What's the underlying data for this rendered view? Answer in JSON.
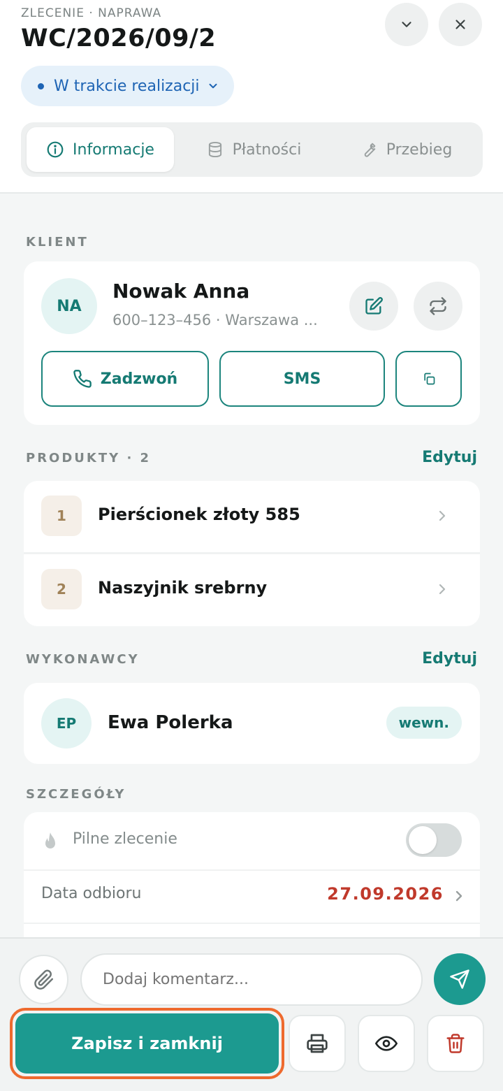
{
  "header": {
    "eyebrow": "ZLECENIE · NAPRAWA",
    "order_number": "WC/2026/09/2",
    "status_label": "W trakcie realizacji",
    "collapse_icon": "chevron-down-icon",
    "close_icon": "close-icon"
  },
  "tabs": [
    {
      "label": "Informacje",
      "icon": "info-icon",
      "active": true
    },
    {
      "label": "Płatności",
      "icon": "database-icon",
      "active": false
    },
    {
      "label": "Przebieg",
      "icon": "wrench-icon",
      "active": false
    }
  ],
  "client": {
    "section_label": "KLIENT",
    "initials": "NA",
    "name": "Nowak Anna",
    "subtitle": "600–123–456 · Warszawa ...",
    "call_label": "Zadzwoń",
    "sms_label": "SMS"
  },
  "products": {
    "section_label": "PRODUKTY · 2",
    "edit_label": "Edytuj",
    "items": [
      {
        "num": "1",
        "name": "Pierścionek złoty 585"
      },
      {
        "num": "2",
        "name": "Naszyjnik srebrny"
      }
    ]
  },
  "contractors": {
    "section_label": "WYKONAWCY",
    "edit_label": "Edytuj",
    "initials": "EP",
    "name": "Ewa Polerka",
    "badge": "wewn."
  },
  "details": {
    "section_label": "SZCZEGÓŁY",
    "urgent_label": "Pilne zlecenie",
    "urgent_on": false,
    "pickup_label": "Data odbioru",
    "pickup_value": "27.09.2026"
  },
  "footer": {
    "comment_placeholder": "Dodaj komentarz...",
    "save_label": "Zapisz i zamknij"
  },
  "colors": {
    "accent": "#1c9a90",
    "accent_dark": "#157a73",
    "status_blue": "#1e64b4",
    "danger": "#c0392b",
    "highlight_outline": "#ee6a2e"
  }
}
